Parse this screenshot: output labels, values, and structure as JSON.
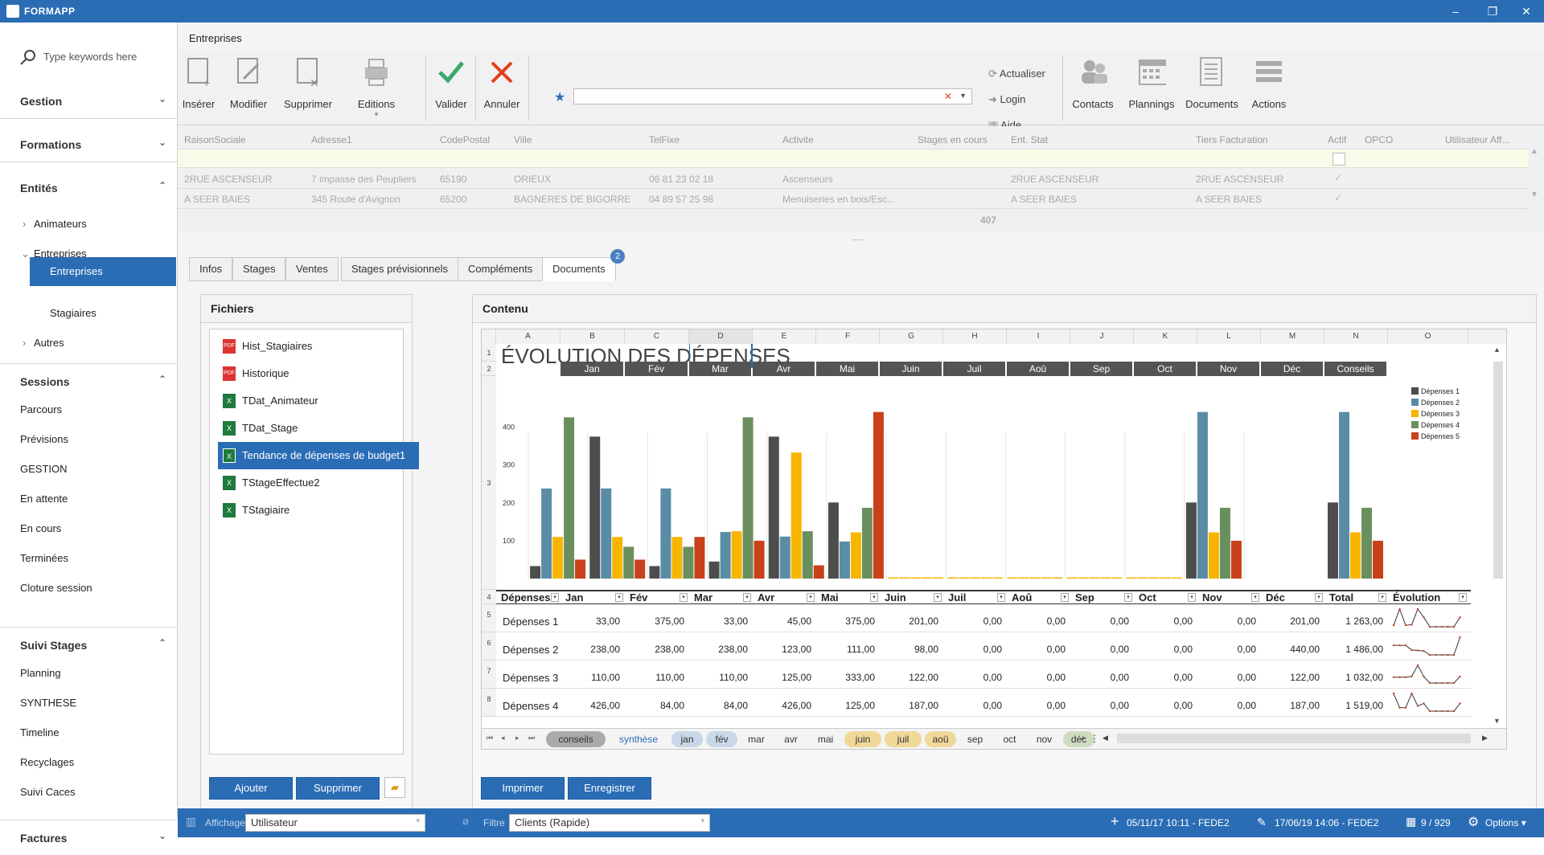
{
  "app": {
    "title": "FORMAPP"
  },
  "sidebar": {
    "search_placeholder": "Type keywords here",
    "sections": [
      {
        "label": "Gestion"
      },
      {
        "label": "Formations"
      },
      {
        "label": "Entités"
      },
      {
        "label": "Sessions"
      },
      {
        "label": "Suivi Stages"
      },
      {
        "label": "Factures"
      }
    ],
    "entites": {
      "animateurs": "Animateurs",
      "entreprises": "Entreprises",
      "entreprises_sub": "Entreprises",
      "stagiaires": "Stagiaires",
      "autres": "Autres"
    },
    "sessions": [
      "Parcours",
      "Prévisions",
      "GESTION",
      "En attente",
      "En cours",
      "Terminées",
      "Cloture session"
    ],
    "suivi": [
      "Planning",
      "SYNTHESE",
      "Timeline",
      "Recyclages",
      "Suivi Caces"
    ]
  },
  "breadcrumb": "Entreprises",
  "ribbon": {
    "inserer": "Insérer",
    "modifier": "Modifier",
    "supprimer": "Supprimer",
    "editions": "Editions",
    "valider": "Valider",
    "annuler": "Annuler",
    "actualiser": "Actualiser",
    "login": "Login",
    "aide": "Aide",
    "contacts": "Contacts",
    "plannings": "Plannings",
    "documents": "Documents",
    "actions": "Actions"
  },
  "grid": {
    "columns": [
      "RaisonSociale",
      "Adresse1",
      "CodePostal",
      "Ville",
      "TelFixe",
      "Activite",
      "Stages en cours",
      "Ent. Stat",
      "Tiers Facturation",
      "Actif",
      "OPCO",
      "Utilisateur Aff..."
    ],
    "rows": [
      [
        "2RUE ASCENSEUR",
        "7 impasse des Peupliers",
        "65190",
        "ORIEUX",
        "06 81 23 02 18",
        "Ascenseurs",
        "",
        "2RUE ASCENSEUR",
        "2RUE ASCENSEUR",
        "✓",
        "",
        ""
      ],
      [
        "A SEER BAIES",
        "345 Route d'Avignon",
        "65200",
        "BAGNERES DE BIGORRE",
        "04 89 57 25 98",
        "Menuiseries en bois/Esc...",
        "",
        "A SEER BAIES",
        "A SEER BAIES",
        "✓",
        "",
        ""
      ]
    ],
    "count": "407"
  },
  "tabs": [
    "Infos",
    "Stages",
    "Ventes",
    "Stages prévisionnels",
    "Compléments",
    "Documents"
  ],
  "tab_badge": "2",
  "fichiers": {
    "title": "Fichiers",
    "files": [
      {
        "name": "Hist_Stagiaires",
        "type": "pdf"
      },
      {
        "name": "Historique",
        "type": "pdf"
      },
      {
        "name": "TDat_Animateur",
        "type": "xls"
      },
      {
        "name": "TDat_Stage",
        "type": "xls"
      },
      {
        "name": "Tendance de dépenses de budget1",
        "type": "xls"
      },
      {
        "name": "TStageEffectue2",
        "type": "xls"
      },
      {
        "name": "TStagiaire",
        "type": "xls"
      }
    ],
    "ajouter": "Ajouter",
    "supprimer": "Supprimer"
  },
  "contenu": {
    "title": "Contenu",
    "sheet_title": "ÉVOLUTION DES DÉPENSES",
    "col_letters": [
      "A",
      "B",
      "C",
      "D",
      "E",
      "F",
      "G",
      "H",
      "I",
      "J",
      "K",
      "L",
      "M",
      "N",
      "O"
    ],
    "months_header": [
      "Jan",
      "Fév",
      "Mar",
      "Avr",
      "Mai",
      "Juin",
      "Juil",
      "Aoû",
      "Sep",
      "Oct",
      "Nov",
      "Déc",
      "Conseils"
    ],
    "table_header": [
      "Dépenses",
      "Jan",
      "Fév",
      "Mar",
      "Avr",
      "Mai",
      "Juin",
      "Juil",
      "Aoû",
      "Sep",
      "Oct",
      "Nov",
      "Déc",
      "Total",
      "Évolution"
    ],
    "table_rows": [
      [
        "Dépenses 1",
        "33,00",
        "375,00",
        "33,00",
        "45,00",
        "375,00",
        "201,00",
        "0,00",
        "0,00",
        "0,00",
        "0,00",
        "0,00",
        "201,00",
        "1 263,00"
      ],
      [
        "Dépenses 2",
        "238,00",
        "238,00",
        "238,00",
        "123,00",
        "111,00",
        "98,00",
        "0,00",
        "0,00",
        "0,00",
        "0,00",
        "0,00",
        "440,00",
        "1 486,00"
      ],
      [
        "Dépenses 3",
        "110,00",
        "110,00",
        "110,00",
        "125,00",
        "333,00",
        "122,00",
        "0,00",
        "0,00",
        "0,00",
        "0,00",
        "0,00",
        "122,00",
        "1 032,00"
      ],
      [
        "Dépenses 4",
        "426,00",
        "84,00",
        "84,00",
        "426,00",
        "125,00",
        "187,00",
        "0,00",
        "0,00",
        "0,00",
        "0,00",
        "0,00",
        "187,00",
        "1 519,00"
      ]
    ],
    "sheet_tabs": [
      "conseils",
      "synthèse",
      "jan",
      "fév",
      "mar",
      "avr",
      "mai",
      "juin",
      "juil",
      "aoû",
      "sep",
      "oct",
      "nov",
      "déc"
    ],
    "imprimer": "Imprimer",
    "enregistrer": "Enregistrer"
  },
  "chart_data": {
    "type": "bar",
    "categories": [
      "Jan",
      "Fév",
      "Mar",
      "Avr",
      "Mai",
      "Juin",
      "Juil",
      "Aoû",
      "Sep",
      "Oct",
      "Nov",
      "Déc"
    ],
    "series": [
      {
        "name": "Dépenses 1",
        "values": [
          33,
          375,
          33,
          45,
          375,
          201,
          0,
          0,
          0,
          0,
          0,
          201
        ]
      },
      {
        "name": "Dépenses 2",
        "values": [
          238,
          238,
          238,
          123,
          111,
          98,
          0,
          0,
          0,
          0,
          0,
          440
        ]
      },
      {
        "name": "Dépenses 3",
        "values": [
          110,
          110,
          110,
          125,
          333,
          122,
          0,
          0,
          0,
          0,
          0,
          122
        ]
      },
      {
        "name": "Dépenses 4",
        "values": [
          426,
          84,
          84,
          426,
          125,
          187,
          0,
          0,
          0,
          0,
          0,
          187
        ]
      },
      {
        "name": "Dépenses 5",
        "values": [
          50,
          50,
          110,
          100,
          35,
          440,
          0,
          0,
          0,
          0,
          0,
          100
        ]
      }
    ],
    "colors": [
      "#4d4d4d",
      "#5b8ca6",
      "#f7b500",
      "#6a8f5e",
      "#c9411a"
    ],
    "yticks": [
      100,
      200,
      300,
      400
    ],
    "ylim": [
      0,
      450
    ],
    "legend": "top-right"
  },
  "status": {
    "affichage_label": "Affichage",
    "affichage_value": "Utilisateur",
    "filtre_label": "Filtre",
    "filtre_value": "Clients (Rapide)",
    "created": "05/11/17 10:11 - FEDE2",
    "modified": "17/06/19 14:06 - FEDE2",
    "record": "9 / 929",
    "options": "Options"
  }
}
